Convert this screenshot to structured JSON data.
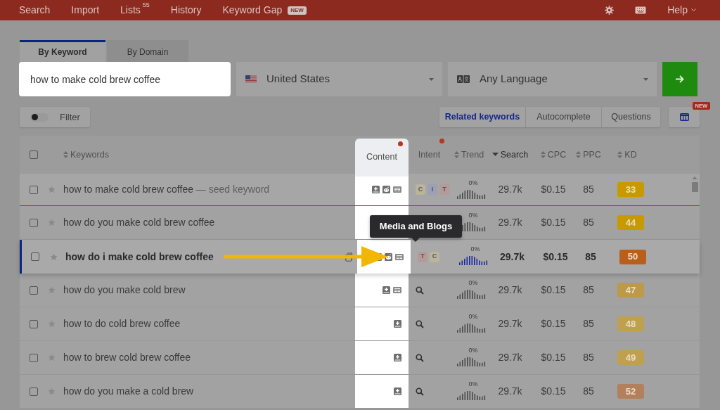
{
  "nav": {
    "items": [
      {
        "label": "Search"
      },
      {
        "label": "Import"
      },
      {
        "label": "Lists",
        "count": "55"
      },
      {
        "label": "History"
      },
      {
        "label": "Keyword Gap",
        "badge": "NEW"
      }
    ],
    "help": "Help"
  },
  "tabs": [
    {
      "label": "By Keyword",
      "selected": true
    },
    {
      "label": "By Domain",
      "selected": false
    }
  ],
  "search": {
    "value": "how to make cold brew coffee"
  },
  "country": {
    "value": "United States"
  },
  "language": {
    "value": "Any Language"
  },
  "filter": {
    "label": "Filter",
    "on": false
  },
  "views": [
    {
      "label": "Related keywords",
      "selected": true
    },
    {
      "label": "Autocomplete",
      "selected": false
    },
    {
      "label": "Questions",
      "selected": false
    }
  ],
  "columns_button": {
    "badge": "NEW"
  },
  "table": {
    "header_checked": false,
    "columns": [
      {
        "label": "Keywords",
        "sortable": true,
        "sorted": false,
        "dot": false
      },
      {
        "label": "Content",
        "sortable": false,
        "sorted": false,
        "dot": true
      },
      {
        "label": "Intent",
        "sortable": false,
        "sorted": false,
        "dot": true
      },
      {
        "label": "Trend",
        "sortable": true,
        "sorted": false,
        "dot": false
      },
      {
        "label": "Search",
        "sortable": true,
        "sorted": true,
        "dot": false
      },
      {
        "label": "CPC",
        "sortable": true,
        "sorted": false,
        "dot": false
      },
      {
        "label": "PPC",
        "sortable": true,
        "sorted": false,
        "dot": false
      },
      {
        "label": "KD",
        "sortable": true,
        "sorted": false,
        "dot": false
      }
    ],
    "rows": [
      {
        "keyword": "how to make cold brew coffee",
        "suffix": "— seed keyword",
        "checked": false,
        "selected": false,
        "seed": true,
        "content": [
          {
            "kind": "book"
          },
          {
            "kind": "robot"
          },
          {
            "kind": "news"
          }
        ],
        "intent": [
          {
            "kind": "badge",
            "letter": "C",
            "color": "#b9b49a"
          },
          {
            "kind": "badge",
            "letter": "I",
            "color": "#9c9fb6"
          },
          {
            "kind": "badge",
            "letter": "T",
            "color": "#b59a98"
          }
        ],
        "trend": "0%",
        "search": "29.7k",
        "cpc": "$0.15",
        "ppc": "85",
        "kd": "33",
        "color": "#c99a00"
      },
      {
        "keyword": "how do you make cold brew coffee",
        "checked": false,
        "selected": false,
        "seed": false,
        "trend": "0%",
        "search": "29.7k",
        "cpc": "$0.15",
        "ppc": "85",
        "kd": "44",
        "color": "#c99a00"
      },
      {
        "keyword": "how do i make cold brew coffee",
        "checked": false,
        "selected": true,
        "seed": false,
        "copy": true,
        "content": [
          {
            "kind": "book"
          },
          {
            "kind": "robot"
          },
          {
            "kind": "news"
          }
        ],
        "intent": [
          {
            "kind": "badge",
            "letter": "T",
            "color": "#b59a98"
          },
          {
            "kind": "badge",
            "letter": "C",
            "color": "#b9b49a"
          }
        ],
        "trend": "0%",
        "search": "29.7k",
        "cpc": "$0.15",
        "ppc": "85",
        "kd": "50",
        "color": "#b95f1c"
      },
      {
        "keyword": "how do you make cold brew",
        "checked": false,
        "selected": false,
        "seed": false,
        "content": [
          {
            "kind": "book"
          },
          {
            "kind": "news"
          }
        ],
        "intent": [
          {
            "kind": "search"
          }
        ],
        "trend": "0%",
        "search": "29.7k",
        "cpc": "$0.15",
        "ppc": "85",
        "kd": "47",
        "color": "#bd9a48"
      },
      {
        "keyword": "how to do cold brew coffee",
        "checked": false,
        "selected": false,
        "seed": false,
        "content": [
          {
            "kind": "book"
          }
        ],
        "intent": [
          {
            "kind": "search"
          }
        ],
        "trend": "0%",
        "search": "29.7k",
        "cpc": "$0.15",
        "ppc": "85",
        "kd": "48",
        "color": "#bfa04e"
      },
      {
        "keyword": "how to brew cold brew coffee",
        "checked": false,
        "selected": false,
        "seed": false,
        "content": [
          {
            "kind": "book"
          }
        ],
        "intent": [
          {
            "kind": "search"
          }
        ],
        "trend": "0%",
        "search": "29.7k",
        "cpc": "$0.15",
        "ppc": "85",
        "kd": "49",
        "color": "#bfa04e"
      },
      {
        "keyword": "how do you make a cold brew",
        "checked": false,
        "selected": false,
        "seed": false,
        "content": [
          {
            "kind": "book"
          }
        ],
        "intent": [
          {
            "kind": "search"
          }
        ],
        "trend": "0%",
        "search": "29.7k",
        "cpc": "$0.15",
        "ppc": "85",
        "kd": "52",
        "color": "#b3805e"
      }
    ]
  },
  "tooltip": {
    "text": "Media and Blogs"
  }
}
